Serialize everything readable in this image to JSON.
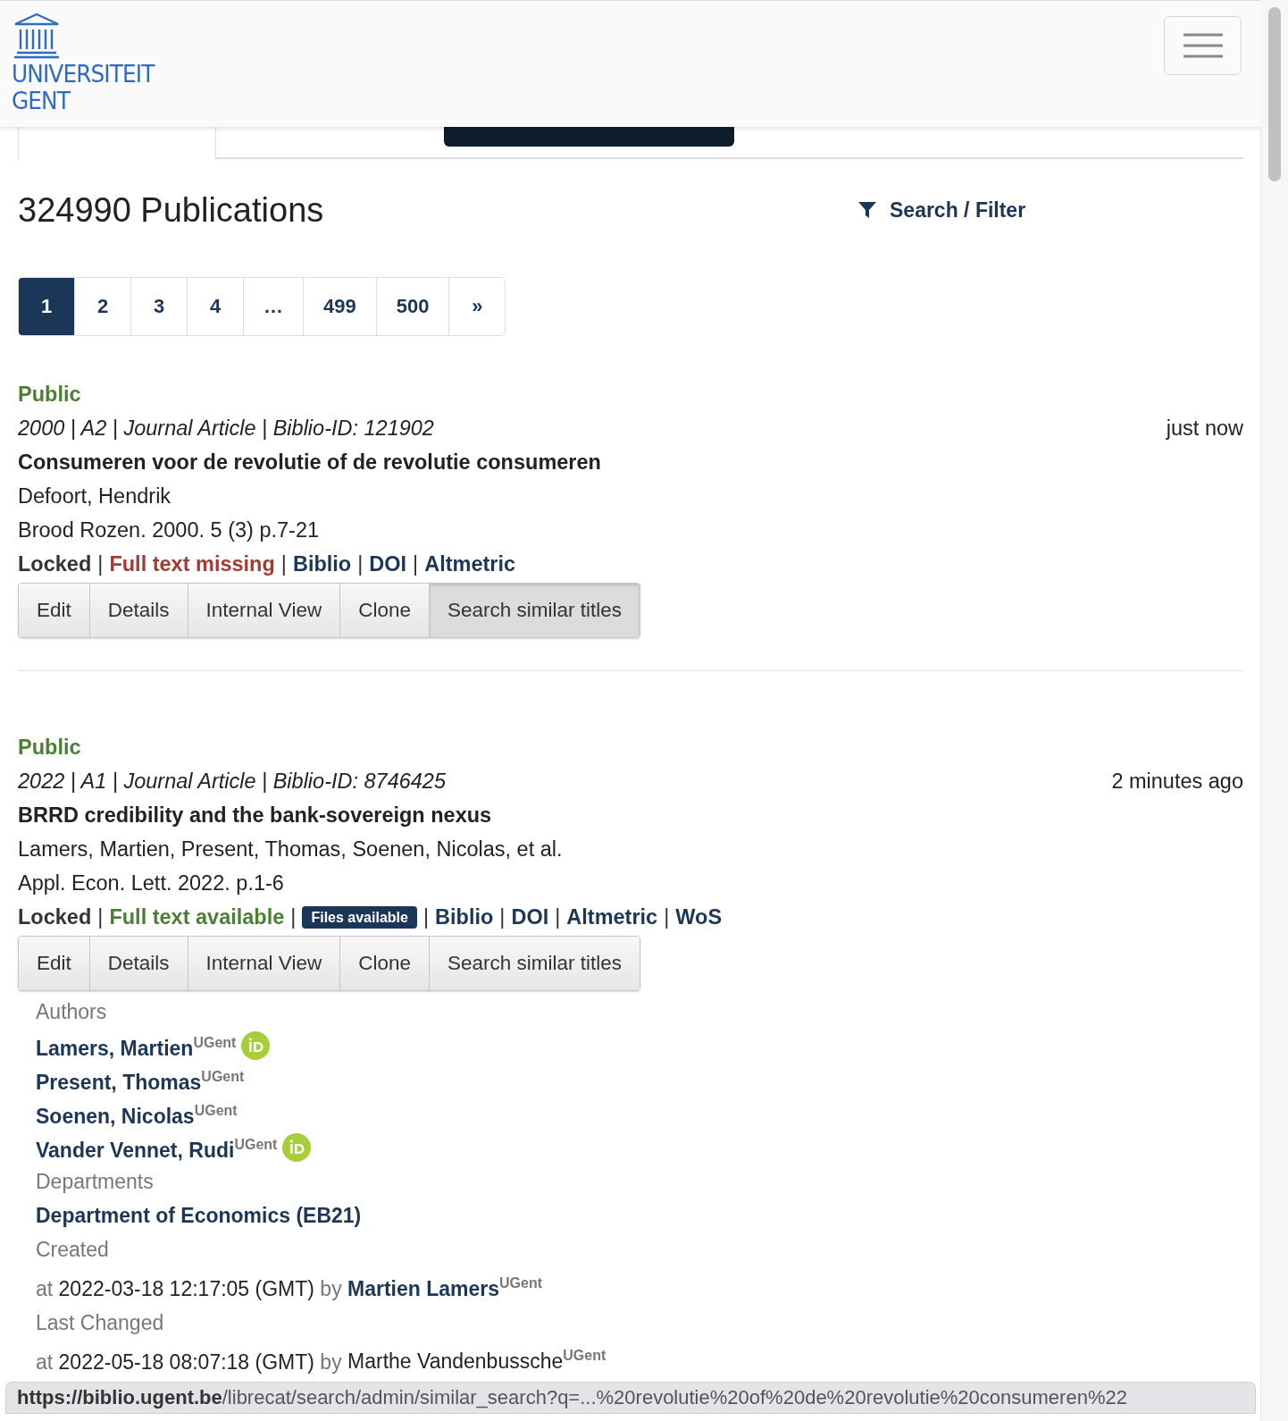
{
  "header": {
    "logo_lines": [
      "UNIVERSITEIT",
      "GENT"
    ]
  },
  "tabs": [
    {
      "selected": true
    }
  ],
  "heading": {
    "title": "324990 Publications",
    "filter_link": "Search / Filter"
  },
  "pagination": [
    {
      "label": "1",
      "selected": true
    },
    {
      "label": "2",
      "selected": false
    },
    {
      "label": "3",
      "selected": false
    },
    {
      "label": "4",
      "selected": false
    },
    {
      "label": "…",
      "selected": false
    },
    {
      "label": "499",
      "selected": false
    },
    {
      "label": "500",
      "selected": false
    },
    {
      "label": "»",
      "selected": false
    }
  ],
  "records": [
    {
      "status": "Public",
      "meta": "2000 | A2 | Journal Article | Biblio-ID: 121902",
      "time": "just now",
      "title": "Consumeren voor de revolutie of de revolutie consumeren",
      "authors_line": "Defoort, Hendrik",
      "source": "Brood Rozen. 2000. 5 (3) p.7-21",
      "separator": "|",
      "links": [
        {
          "kind": "locked",
          "text": "Locked"
        },
        {
          "kind": "missing",
          "text": "Full text missing"
        },
        {
          "kind": "link",
          "text": "Biblio"
        },
        {
          "kind": "link",
          "text": "DOI"
        },
        {
          "kind": "link",
          "text": "Altmetric"
        }
      ],
      "buttons": [
        {
          "label": "Edit",
          "pressed": false
        },
        {
          "label": "Details",
          "pressed": false
        },
        {
          "label": "Internal View",
          "pressed": false
        },
        {
          "label": "Clone",
          "pressed": false
        },
        {
          "label": "Search similar titles",
          "pressed": true
        }
      ]
    },
    {
      "status": "Public",
      "meta": "2022 | A1 | Journal Article | Biblio-ID: 8746425",
      "time": "2 minutes ago",
      "title": "BRRD credibility and the bank-sovereign nexus",
      "authors_line": "Lamers, Martien, Present, Thomas, Soenen, Nicolas, et al.",
      "source": "Appl. Econ. Lett. 2022. p.1-6",
      "separator": "|",
      "links": [
        {
          "kind": "locked",
          "text": "Locked"
        },
        {
          "kind": "available",
          "text": "Full text available"
        },
        {
          "kind": "badge",
          "text": "Files available"
        },
        {
          "kind": "link",
          "text": "Biblio"
        },
        {
          "kind": "link",
          "text": "DOI"
        },
        {
          "kind": "link",
          "text": "Altmetric"
        },
        {
          "kind": "link",
          "text": "WoS"
        }
      ],
      "buttons": [
        {
          "label": "Edit",
          "pressed": false
        },
        {
          "label": "Details",
          "pressed": false
        },
        {
          "label": "Internal View",
          "pressed": false
        },
        {
          "label": "Clone",
          "pressed": false
        },
        {
          "label": "Search similar titles",
          "pressed": false
        }
      ],
      "details": {
        "authors_label": "Authors",
        "authors": [
          {
            "name": "Lamers, Martien",
            "affiliation": "UGent",
            "orcid": true
          },
          {
            "name": "Present, Thomas",
            "affiliation": "UGent",
            "orcid": false
          },
          {
            "name": "Soenen, Nicolas",
            "affiliation": "UGent",
            "orcid": false
          },
          {
            "name": "Vander Vennet, Rudi",
            "affiliation": "UGent",
            "orcid": true
          }
        ],
        "departments_label": "Departments",
        "departments": [
          "Department of Economics (EB21)"
        ],
        "events": [
          {
            "label": "Created",
            "at": "at",
            "date": "2022-03-18 12:17:05 (GMT)",
            "by": "by",
            "person": "Martien Lamers",
            "person_link": true,
            "affiliation": "UGent"
          },
          {
            "label": "Last Changed",
            "at": "at",
            "date": "2022-05-18 08:07:18 (GMT)",
            "by": "by",
            "person": "Marthe Vandenbussche",
            "person_link": false,
            "affiliation": "UGent"
          }
        ]
      }
    }
  ],
  "status_bar": {
    "url": "**https://biblio.ugent.be**/librecat/search/admin/similar_search?q=...%20revolutie%20of%20de%20revolutie%20consumeren%22"
  }
}
